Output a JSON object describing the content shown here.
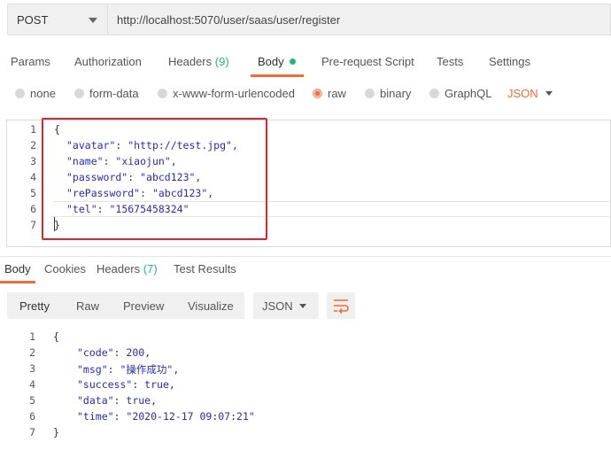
{
  "request": {
    "method": "POST",
    "url": "http://localhost:5070/user/saas/user/register"
  },
  "tabs": [
    {
      "label": "Params"
    },
    {
      "label": "Authorization"
    },
    {
      "label": "Headers",
      "count": "(9)"
    },
    {
      "label": "Body"
    },
    {
      "label": "Pre-request Script"
    },
    {
      "label": "Tests"
    },
    {
      "label": "Settings"
    }
  ],
  "body_types": [
    "none",
    "form-data",
    "x-www-form-urlencoded",
    "raw",
    "binary",
    "GraphQL"
  ],
  "body_format": "JSON",
  "request_body": {
    "lines": [
      {
        "n": "1",
        "text": "{"
      },
      {
        "n": "2",
        "key": "\"avatar\"",
        "val": "\"http://test.jpg\","
      },
      {
        "n": "3",
        "key": "\"name\"",
        "val": "\"xiaojun\","
      },
      {
        "n": "4",
        "key": "\"password\"",
        "val": "\"abcd123\","
      },
      {
        "n": "5",
        "key": "\"rePassword\"",
        "val": "\"abcd123\","
      },
      {
        "n": "6",
        "key": "\"tel\"",
        "val": "\"15675458324\""
      },
      {
        "n": "7",
        "text": "}"
      }
    ]
  },
  "response_tabs": [
    {
      "label": "Body"
    },
    {
      "label": "Cookies"
    },
    {
      "label": "Headers",
      "count": "(7)"
    },
    {
      "label": "Test Results"
    }
  ],
  "view_modes": [
    "Pretty",
    "Raw",
    "Preview",
    "Visualize"
  ],
  "response_format": "JSON",
  "response_body": {
    "lines": [
      {
        "n": "1",
        "text": "{"
      },
      {
        "n": "2",
        "key": "\"code\"",
        "val": "200,"
      },
      {
        "n": "3",
        "key": "\"msg\"",
        "val": "\"操作成功\","
      },
      {
        "n": "4",
        "key": "\"success\"",
        "val": "true,"
      },
      {
        "n": "5",
        "key": "\"data\"",
        "val": "true,"
      },
      {
        "n": "6",
        "key": "\"time\"",
        "val": "\"2020-12-17 09:07:21\""
      },
      {
        "n": "7",
        "text": "}"
      }
    ]
  },
  "colors": {
    "accent": "#f26b3a",
    "count": "#26b47f",
    "highlight_box": "#e0242a"
  },
  "icons": [
    "chevron-down-icon",
    "wrap-lines-icon",
    "radio-icon",
    "status-dot-icon"
  ]
}
